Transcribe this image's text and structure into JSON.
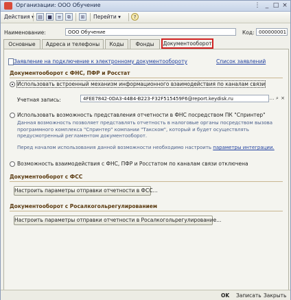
{
  "window": {
    "title": "Организации: ООО Обучение"
  },
  "toolbar": {
    "actions_label": "Действия",
    "goto_label": "Перейти",
    "help_label": "?"
  },
  "header": {
    "name_label": "Наименование:",
    "name_value": "ООО Обучение",
    "code_label": "Код:",
    "code_value": "000000001"
  },
  "tabs": [
    {
      "label": "Основные"
    },
    {
      "label": "Адреса и телефоны"
    },
    {
      "label": "Коды"
    },
    {
      "label": "Фонды"
    },
    {
      "label": "Документооборот"
    }
  ],
  "edoc": {
    "apply_link": "Заявление на подключение к электронному документообороту",
    "list_link": "Список заявлений",
    "section_fns": "Документооборот с ФНС, ПФР и Росстат",
    "opt_builtin": "Использовать встроенный механизм информационного взаимодействия по каналам связи",
    "account_label": "Учетная запись:",
    "account_value": "4FEE7842-0DA3-44B4-B223-F32F515459F6@report.keydisk.ru",
    "opt_sprinter": "Использовать возможность представления отчетности в ФНС посредством ПК \"Спринтер\"",
    "sprinter_desc_1": "Данная возможность позволяет представлять отчетность в налоговые органы посредством вызова",
    "sprinter_desc_2": "программного комплекса \"Спринтер\" компании \"Такском\", который и будет осуществлять",
    "sprinter_desc_3": "предусмотренный регламентом документооборот.",
    "sprinter_note_prefix": "Перед началом использования данной возможности необходимо настроить",
    "sprinter_note_link": "параметры интеграции.",
    "opt_disabled": "Возможность взаимодействия с ФНС, ПФР и Росстатом по каналам связи отключена",
    "section_fss": "Документооборот с ФСС",
    "btn_fss": "Настроить параметры отправки отчетности в ФСС...",
    "section_ral": "Документооборот с Росалкогольрегулированием",
    "btn_ral": "Настроить параметры отправки отчетности в Росалкогольрегулирование..."
  },
  "footer": {
    "ok_label": "OK",
    "save_label": "Записать",
    "close_label": "Закрыть"
  }
}
